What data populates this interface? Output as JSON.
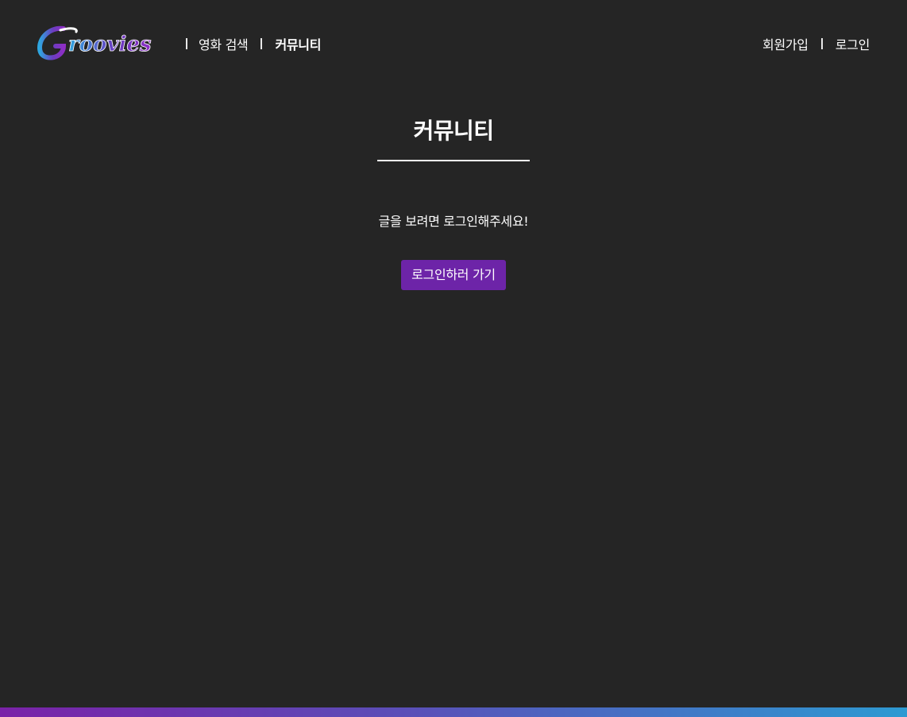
{
  "header": {
    "logo_text": "Groovies",
    "nav_left": [
      {
        "label": "영화 검색",
        "active": false
      },
      {
        "label": "커뮤니티",
        "active": true
      }
    ],
    "nav_right": [
      {
        "label": "회원가입"
      },
      {
        "label": "로그인"
      }
    ]
  },
  "main": {
    "title": "커뮤니티",
    "message": "글을 보려면 로그인해주세요!",
    "login_button_label": "로그인하러 가기"
  },
  "colors": {
    "background": "#252525",
    "text": "#ffffff",
    "button": "#6d24a8",
    "gradient_start": "#7a22a8",
    "gradient_end": "#2d9ad2"
  },
  "icons": {
    "logo": "groovies-logo"
  }
}
